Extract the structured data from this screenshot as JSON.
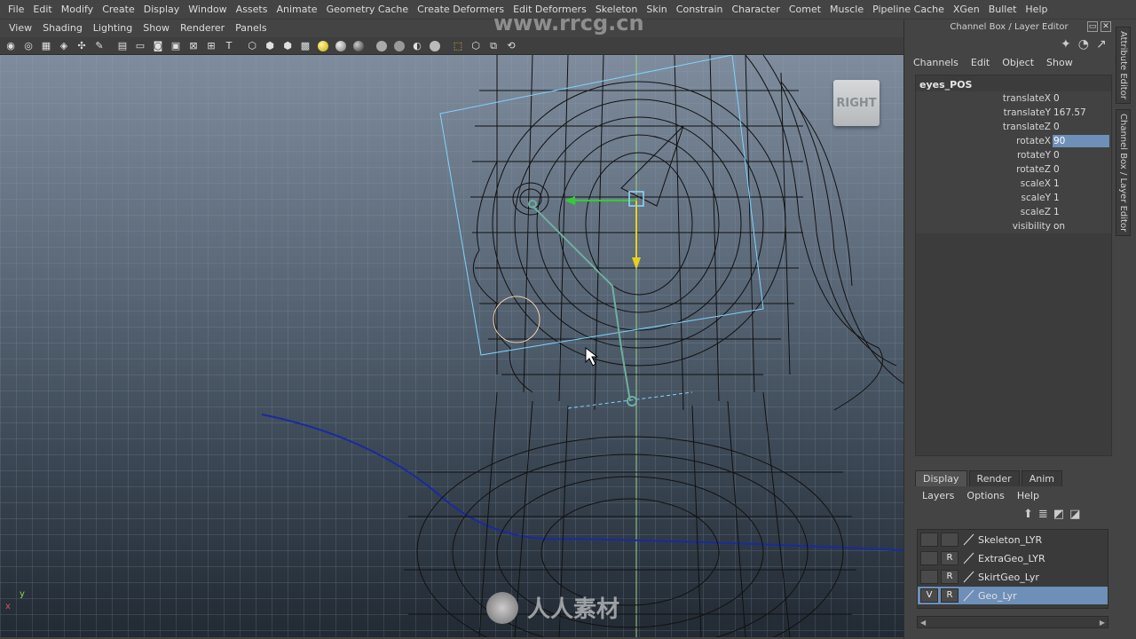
{
  "menubar": {
    "items": [
      "File",
      "Edit",
      "Modify",
      "Create",
      "Display",
      "Window",
      "Assets",
      "Animate",
      "Geometry Cache",
      "Create Deformers",
      "Edit Deformers",
      "Skeleton",
      "Skin",
      "Constrain",
      "Character",
      "Comet",
      "Muscle",
      "Pipeline Cache",
      "XGen",
      "Bullet",
      "Help"
    ]
  },
  "panel_menu": {
    "items": [
      "View",
      "Shading",
      "Lighting",
      "Show",
      "Renderer",
      "Panels"
    ]
  },
  "viewport": {
    "camera_label": "RIGHT",
    "axis_y": "y",
    "axis_x": "x",
    "watermark_top": "www.rrcg.cn",
    "watermark_bottom": "人人素材"
  },
  "right_panel": {
    "title": "Channel Box / Layer Editor",
    "menu": [
      "Channels",
      "Edit",
      "Object",
      "Show"
    ],
    "object_name": "eyes_POS",
    "attributes": [
      {
        "name": "translateX",
        "value": "0"
      },
      {
        "name": "translateY",
        "value": "167.57"
      },
      {
        "name": "translateZ",
        "value": "0"
      },
      {
        "name": "rotateX",
        "value": "90"
      },
      {
        "name": "rotateY",
        "value": "0"
      },
      {
        "name": "rotateZ",
        "value": "0"
      },
      {
        "name": "scaleX",
        "value": "1"
      },
      {
        "name": "scaleY",
        "value": "1"
      },
      {
        "name": "scaleZ",
        "value": "1"
      },
      {
        "name": "visibility",
        "value": "on"
      }
    ],
    "selected_attribute": "rotateX",
    "side_tabs": [
      "Attribute Editor",
      "Channel Box / Layer Editor"
    ]
  },
  "layer_editor": {
    "tabs": [
      "Display",
      "Render",
      "Anim"
    ],
    "active_tab": "Display",
    "menu": [
      "Layers",
      "Options",
      "Help"
    ],
    "layers": [
      {
        "v": "",
        "r": "",
        "name": "Skeleton_LYR"
      },
      {
        "v": "",
        "r": "R",
        "name": "ExtraGeo_LYR"
      },
      {
        "v": "",
        "r": "R",
        "name": "SkirtGeo_Lyr"
      },
      {
        "v": "V",
        "r": "R",
        "name": "Geo_Lyr"
      }
    ],
    "selected_layer": "Geo_Lyr"
  },
  "colors": {
    "selection": "#6d8fb8",
    "bg_panel": "#444444",
    "manip_green": "#33cc33",
    "manip_yellow": "#e8d020",
    "curve_blue": "#1a2aa0",
    "frame_cyan": "#7fd4ff"
  }
}
